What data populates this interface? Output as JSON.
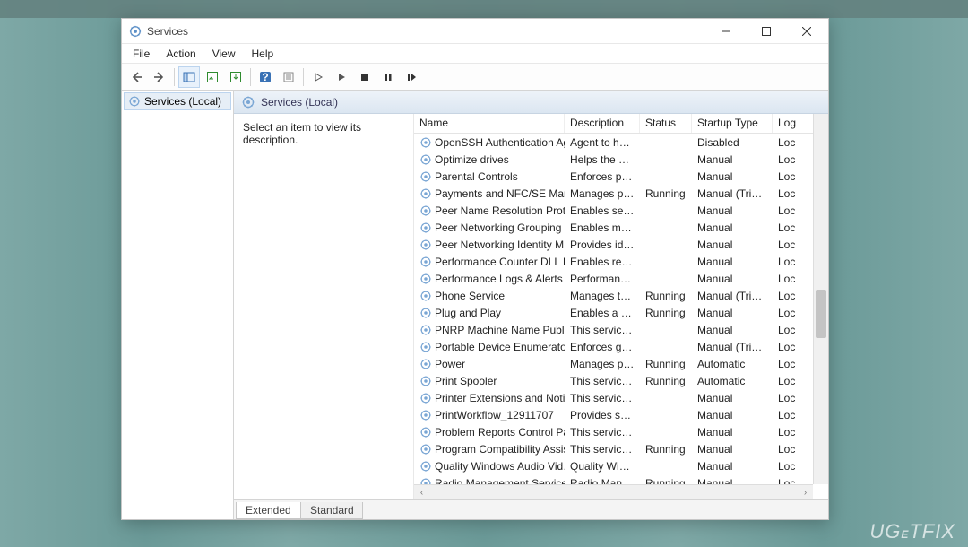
{
  "background_tabs": [
    "",
    "",
    "",
    "",
    "",
    ""
  ],
  "window": {
    "title": "Services",
    "menu": [
      "File",
      "Action",
      "View",
      "Help"
    ]
  },
  "leftpane": {
    "root": "Services (Local)"
  },
  "pane_header": "Services (Local)",
  "desc_panel": "Select an item to view its description.",
  "columns": [
    "Name",
    "Description",
    "Status",
    "Startup Type",
    "Log"
  ],
  "services": [
    {
      "name": "OpenSSH Authentication Ag…",
      "desc": "Agent to hol…",
      "status": "",
      "startup": "Disabled",
      "logon": "Loc"
    },
    {
      "name": "Optimize drives",
      "desc": "Helps the co…",
      "status": "",
      "startup": "Manual",
      "logon": "Loc"
    },
    {
      "name": "Parental Controls",
      "desc": "Enforces par…",
      "status": "",
      "startup": "Manual",
      "logon": "Loc"
    },
    {
      "name": "Payments and NFC/SE Mana…",
      "desc": "Manages pa…",
      "status": "Running",
      "startup": "Manual (Trigg…",
      "logon": "Loc"
    },
    {
      "name": "Peer Name Resolution Proto…",
      "desc": "Enables serv…",
      "status": "",
      "startup": "Manual",
      "logon": "Loc"
    },
    {
      "name": "Peer Networking Grouping",
      "desc": "Enables mul…",
      "status": "",
      "startup": "Manual",
      "logon": "Loc"
    },
    {
      "name": "Peer Networking Identity M…",
      "desc": "Provides ide…",
      "status": "",
      "startup": "Manual",
      "logon": "Loc"
    },
    {
      "name": "Performance Counter DLL H…",
      "desc": "Enables rem…",
      "status": "",
      "startup": "Manual",
      "logon": "Loc"
    },
    {
      "name": "Performance Logs & Alerts",
      "desc": "Performance…",
      "status": "",
      "startup": "Manual",
      "logon": "Loc"
    },
    {
      "name": "Phone Service",
      "desc": "Manages th…",
      "status": "Running",
      "startup": "Manual (Trigg…",
      "logon": "Loc"
    },
    {
      "name": "Plug and Play",
      "desc": "Enables a co…",
      "status": "Running",
      "startup": "Manual",
      "logon": "Loc"
    },
    {
      "name": "PNRP Machine Name Public…",
      "desc": "This service …",
      "status": "",
      "startup": "Manual",
      "logon": "Loc"
    },
    {
      "name": "Portable Device Enumerator …",
      "desc": "Enforces gro…",
      "status": "",
      "startup": "Manual (Trigg…",
      "logon": "Loc"
    },
    {
      "name": "Power",
      "desc": "Manages po…",
      "status": "Running",
      "startup": "Automatic",
      "logon": "Loc"
    },
    {
      "name": "Print Spooler",
      "desc": "This service …",
      "status": "Running",
      "startup": "Automatic",
      "logon": "Loc"
    },
    {
      "name": "Printer Extensions and Notifi…",
      "desc": "This service …",
      "status": "",
      "startup": "Manual",
      "logon": "Loc"
    },
    {
      "name": "PrintWorkflow_12911707",
      "desc": "Provides sup…",
      "status": "",
      "startup": "Manual",
      "logon": "Loc"
    },
    {
      "name": "Problem Reports Control Pa…",
      "desc": "This service …",
      "status": "",
      "startup": "Manual",
      "logon": "Loc"
    },
    {
      "name": "Program Compatibility Assis…",
      "desc": "This service …",
      "status": "Running",
      "startup": "Manual",
      "logon": "Loc"
    },
    {
      "name": "Quality Windows Audio Vid…",
      "desc": "Quality Win…",
      "status": "",
      "startup": "Manual",
      "logon": "Loc"
    },
    {
      "name": "Radio Management Service",
      "desc": "Radio Mana…",
      "status": "Running",
      "startup": "Manual",
      "logon": "Loc"
    }
  ],
  "tabs": [
    "Extended",
    "Standard"
  ],
  "watermark": "UGETFIX"
}
